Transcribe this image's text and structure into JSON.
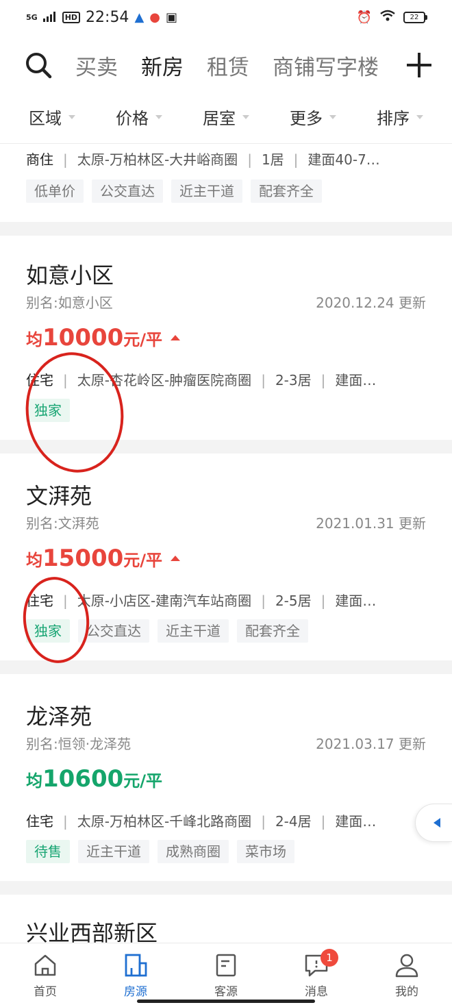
{
  "status_bar": {
    "network": "5G",
    "hd": "HD",
    "time": "22:54",
    "battery": "22"
  },
  "top_nav": {
    "tabs": [
      "买卖",
      "新房",
      "租赁",
      "商铺写字楼"
    ],
    "active_tab": "新房"
  },
  "filters": [
    "区域",
    "价格",
    "居室",
    "更多",
    "排序"
  ],
  "listings": [
    {
      "type": "商住",
      "location": "太原-万柏林区-大井峪商圈",
      "rooms": "1居",
      "area": "建面40-7…",
      "tags": [
        "低单价",
        "公交直达",
        "近主干道",
        "配套齐全"
      ]
    },
    {
      "name": "如意小区",
      "alias": "别名:如意小区",
      "updated": "2020.12.24 更新",
      "price_prefix": "均",
      "price": "10000",
      "price_unit": "元/平",
      "price_color": "#e8453c",
      "type": "住宅",
      "location": "太原-杏花岭区-肿瘤医院商圈",
      "rooms": "2-3居",
      "area": "建面…",
      "tags": [
        "独家"
      ]
    },
    {
      "name": "文湃苑",
      "alias": "别名:文湃苑",
      "updated": "2021.01.31 更新",
      "price_prefix": "均",
      "price": "15000",
      "price_unit": "元/平",
      "price_color": "#e8453c",
      "type": "住宅",
      "location": "太原-小店区-建南汽车站商圈",
      "rooms": "2-5居",
      "area": "建面…",
      "tags": [
        "独家",
        "公交直达",
        "近主干道",
        "配套齐全"
      ]
    },
    {
      "name": "龙泽苑",
      "alias": "别名:恒领·龙泽苑",
      "updated": "2021.03.17 更新",
      "price_prefix": "均",
      "price": "10600",
      "price_unit": "元/平",
      "price_color": "#15a56b",
      "type": "住宅",
      "location": "太原-万柏林区-千峰北路商圈",
      "rooms": "2-4居",
      "area": "建面…",
      "tags": [
        "待售",
        "近主干道",
        "成熟商圈",
        "菜市场"
      ]
    },
    {
      "name": "兴业西部新区"
    }
  ],
  "bottom_nav": {
    "items": [
      "首页",
      "房源",
      "客源",
      "消息",
      "我的"
    ],
    "active": "房源",
    "message_badge": "1"
  },
  "colors": {
    "accent": "#1f6fd1",
    "price_red": "#e8453c",
    "price_green": "#15a56b",
    "annotation_red": "#d8231d"
  }
}
